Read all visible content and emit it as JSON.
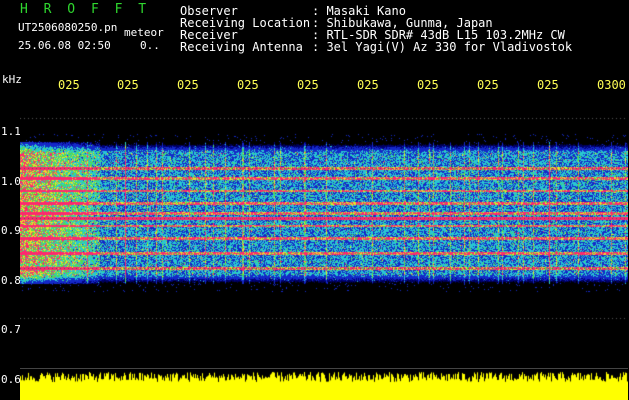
{
  "header": {
    "title": "H R O F F T",
    "filename": "UT2506080250.pn",
    "meteor_label": "meteor",
    "datetime": "25.06.08 02:50",
    "count": "0.."
  },
  "station_info": [
    {
      "label": "Observer",
      "value": ": Masaki Kano"
    },
    {
      "label": "Receiving Location",
      "value": ": Shibukawa, Gunma, Japan"
    },
    {
      "label": "Receiver",
      "value": ": RTL-SDR SDR# 43dB L15 103.2MHz CW"
    },
    {
      "label": "Receiving Antenna",
      "value": ": 3el Yagi(V) Az 330 for Vladivostok"
    }
  ],
  "axis": {
    "unit": "kHz",
    "y_ticks": [
      "1.1",
      "1.0",
      "0.9",
      "0.8",
      "0.7",
      "0.6"
    ],
    "x_ticks": [
      "025",
      "025",
      "025",
      "025",
      "025",
      "025",
      "025",
      "025",
      "025",
      "0300"
    ]
  },
  "spectrogram": {
    "freq_range_khz": [
      0.6,
      1.1
    ],
    "band_khz": [
      0.78,
      1.04
    ],
    "persistent_lines_khz": [
      1.0,
      0.98,
      0.955,
      0.93,
      0.91,
      0.9,
      0.885,
      0.86,
      0.83,
      0.8
    ],
    "colors": {
      "background": "#000000",
      "low": "#1e2fd2",
      "mid": "#2ad2d2",
      "high": "#e8e82a",
      "peak": "#ff2a6a",
      "amplitude": "#ffff00"
    }
  }
}
